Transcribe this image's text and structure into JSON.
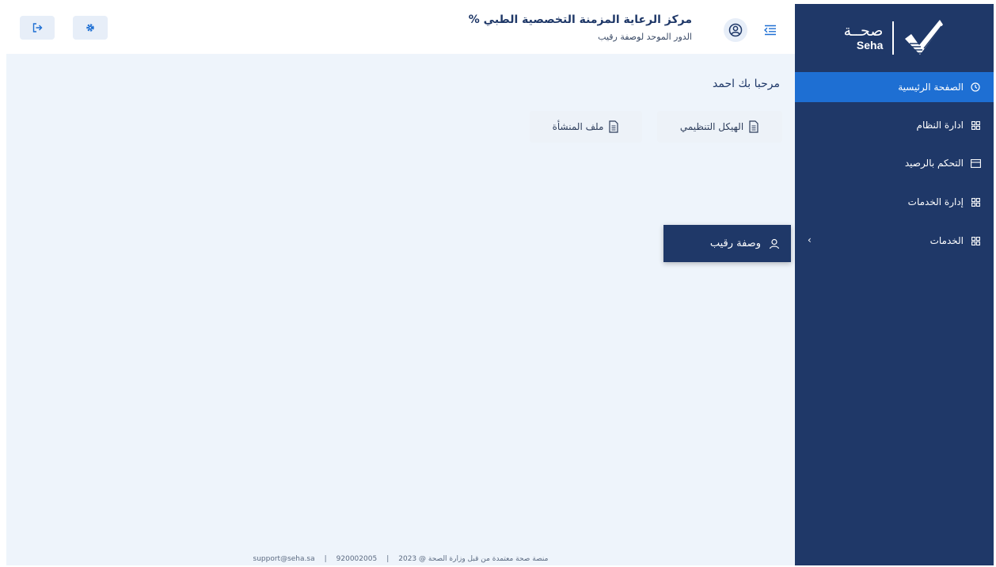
{
  "app": {
    "logo_ar": "صحــة",
    "logo_en": "Seha"
  },
  "sidebar": {
    "items": [
      {
        "label": "الصفحة الرئيسية",
        "icon": "clock-icon",
        "active": true
      },
      {
        "label": "ادارة النظام",
        "icon": "grid-icon",
        "active": false
      },
      {
        "label": "التحكم بالرصيد",
        "icon": "card-icon",
        "active": false
      },
      {
        "label": "إدارة الخدمات",
        "icon": "grid-icon",
        "active": false
      },
      {
        "label": "الخدمات",
        "icon": "grid-icon",
        "active": false,
        "has_submenu": true
      }
    ],
    "submenu": {
      "items": [
        {
          "label": "وصفة رقيب",
          "icon": "user-icon"
        }
      ]
    }
  },
  "header": {
    "org_title": "مركز الرعاية المزمنة التخصصية الطبي %",
    "org_subtitle": "الدور الموحد لوصفة رقيب",
    "settings_icon": "gear-icon",
    "logout_icon": "logout-icon"
  },
  "main": {
    "welcome": "مرحبا بك احمد",
    "quick_links": [
      {
        "label": "الهيكل التنظيمي",
        "icon": "document-icon"
      },
      {
        "label": "ملف المنشأة",
        "icon": "document-icon"
      }
    ]
  },
  "footer": {
    "text": "منصة صحة معتمدة من قبل وزارة الصحة @ 2023",
    "phone": "920002005",
    "email": "support@seha.sa",
    "separator": "|"
  },
  "colors": {
    "sidebar_bg": "#1f3868",
    "accent": "#1e6fd3",
    "content_bg": "#eef4fb"
  }
}
